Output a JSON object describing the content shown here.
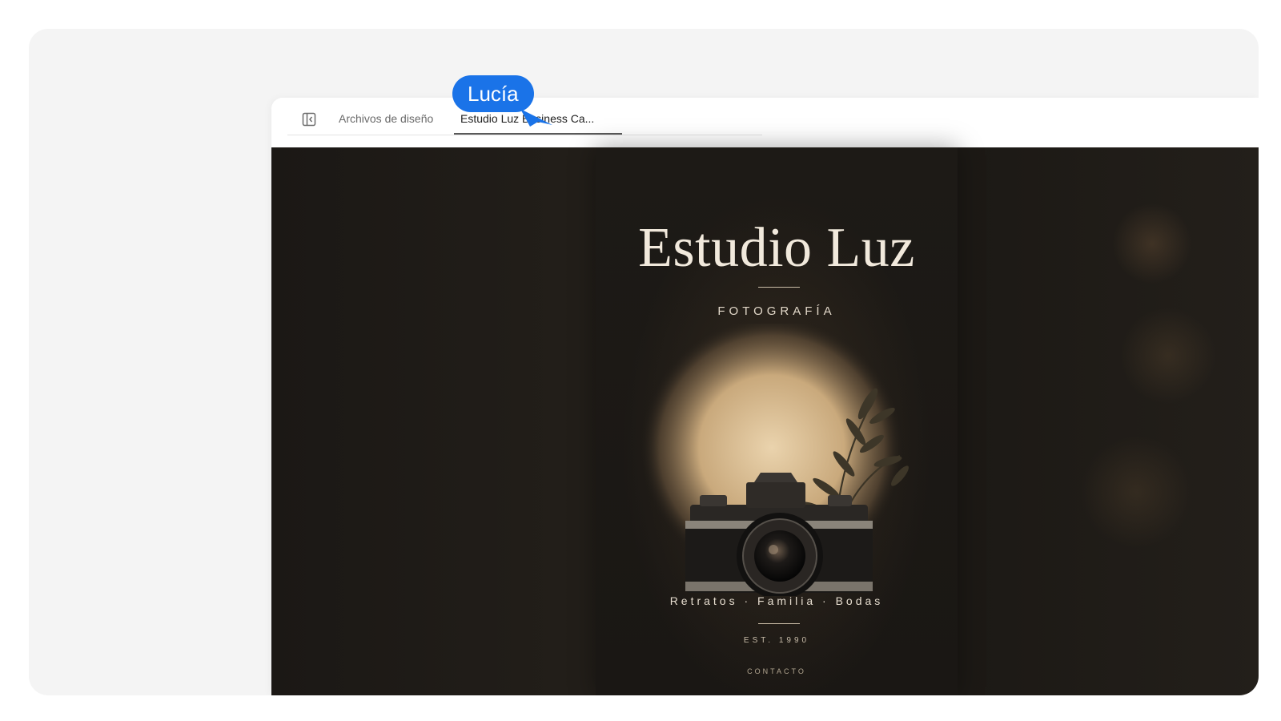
{
  "tabs": {
    "files_label": "Archivos de diseño",
    "active_label": "Estudio Luz Business Ca..."
  },
  "collaborator": {
    "name": "Lucía",
    "color": "#1a73e8"
  },
  "card": {
    "title": "Estudio Luz",
    "subtitle": "FOTOGRAFÍA",
    "services": "Retratos · Familia · Bodas",
    "established": "EST. 1990",
    "contact": "CONTACTO"
  },
  "icons": {
    "sidebar_toggle": "sidebar-panel-icon"
  },
  "colors": {
    "canvas_background": "#1d1a16",
    "card_text": "#f1e9dc",
    "accent_glow": "#e9cfa5"
  }
}
